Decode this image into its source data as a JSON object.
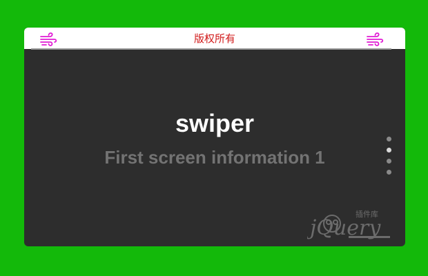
{
  "header": {
    "title": "版权所有",
    "left_icon": "wind-icon",
    "right_icon": "wind-icon",
    "icon_color": "#e11ad4"
  },
  "slide": {
    "title": "swiper",
    "subtitle": "First screen information 1"
  },
  "pagination": {
    "total": 4,
    "active_index": 1
  },
  "watermark": {
    "text": "jQuery",
    "sub_text": "插件库"
  },
  "colors": {
    "background": "#13b90a",
    "panel": "#2d2d2d",
    "title": "#d11a1a"
  }
}
